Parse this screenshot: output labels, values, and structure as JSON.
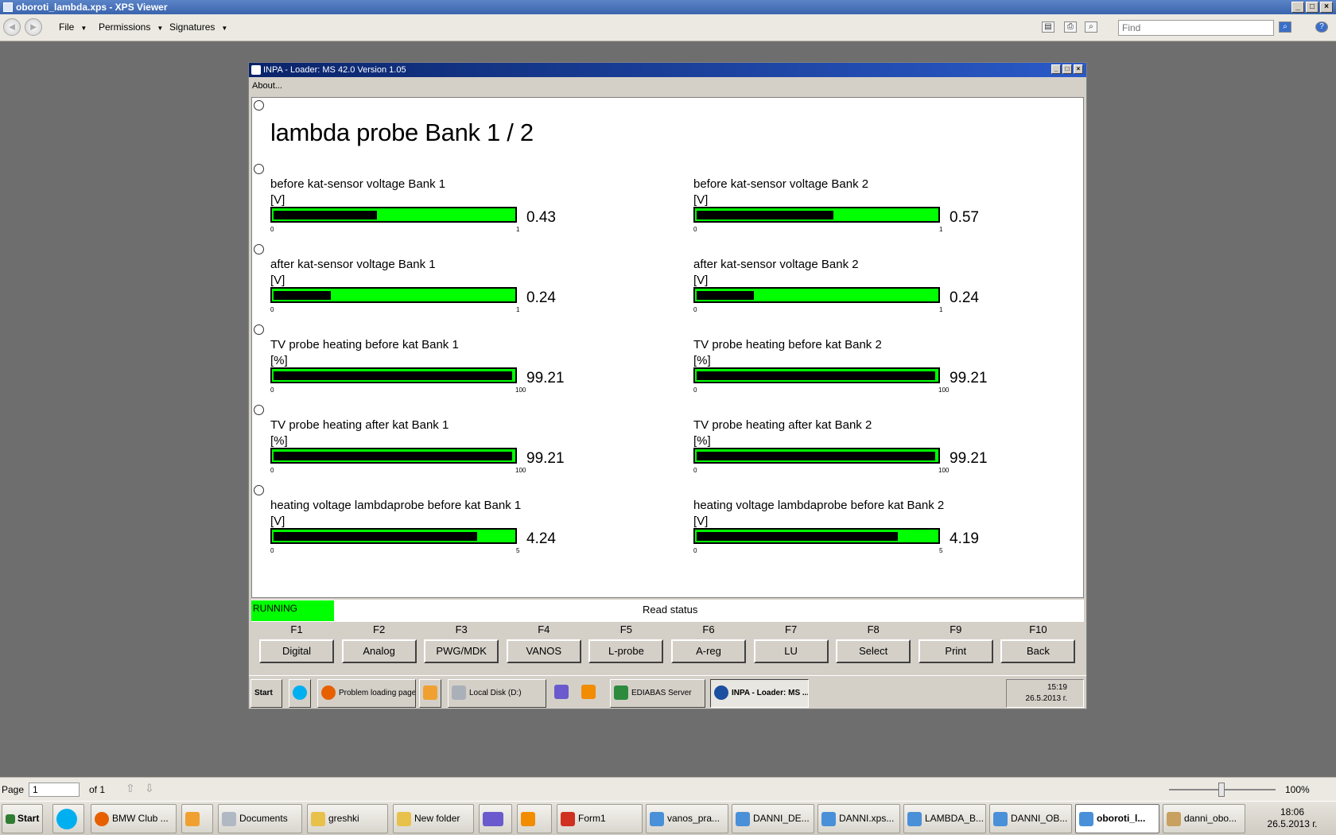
{
  "outer": {
    "title": "oboroti_lambda.xps - XPS Viewer",
    "menus": [
      "File",
      "Permissions",
      "Signatures"
    ],
    "find_placeholder": "Find",
    "page_label": "Page",
    "page_value": "1",
    "page_of": "of 1",
    "zoom": "100%"
  },
  "inner": {
    "title": "INPA - Loader:  MS 42.0 Version 1.05",
    "menu_about": "About...",
    "heading": "lambda probe Bank 1 / 2",
    "gauges": [
      {
        "label": "before kat-sensor voltage Bank 1",
        "unit": "[V]",
        "value": "0.43",
        "fraction": 0.43,
        "min": "0",
        "max": "1"
      },
      {
        "label": "before kat-sensor voltage Bank 2",
        "unit": "[V]",
        "value": "0.57",
        "fraction": 0.57,
        "min": "0",
        "max": "1"
      },
      {
        "label": "after kat-sensor voltage Bank 1",
        "unit": "[V]",
        "value": "0.24",
        "fraction": 0.24,
        "min": "0",
        "max": "1"
      },
      {
        "label": "after kat-sensor voltage Bank 2",
        "unit": "[V]",
        "value": "0.24",
        "fraction": 0.24,
        "min": "0",
        "max": "1"
      },
      {
        "label": "TV probe heating before kat Bank 1",
        "unit": "[%]",
        "value": "99.21",
        "fraction": 0.9921,
        "min": "0",
        "max": "100"
      },
      {
        "label": "TV probe heating before kat Bank 2",
        "unit": "[%]",
        "value": "99.21",
        "fraction": 0.9921,
        "min": "0",
        "max": "100"
      },
      {
        "label": "TV probe heating after kat Bank 1",
        "unit": "[%]",
        "value": "99.21",
        "fraction": 0.9921,
        "min": "0",
        "max": "100"
      },
      {
        "label": "TV probe heating after kat Bank 2",
        "unit": "[%]",
        "value": "99.21",
        "fraction": 0.9921,
        "min": "0",
        "max": "100"
      },
      {
        "label": "heating voltage lambdaprobe before kat Bank 1",
        "unit": "[V]",
        "value": "4.24",
        "fraction": 0.848,
        "min": "0",
        "max": "5"
      },
      {
        "label": "heating voltage lambdaprobe before kat Bank 2",
        "unit": "[V]",
        "value": "4.19",
        "fraction": 0.838,
        "min": "0",
        "max": "5"
      }
    ],
    "status": "RUNNING",
    "read_status": "Read status",
    "fkeys": [
      {
        "key": "F1",
        "label": "Digital"
      },
      {
        "key": "F2",
        "label": "Analog"
      },
      {
        "key": "F3",
        "label": "PWG/MDK"
      },
      {
        "key": "F4",
        "label": "VANOS"
      },
      {
        "key": "F5",
        "label": "L-probe"
      },
      {
        "key": "F6",
        "label": "A-reg"
      },
      {
        "key": "F7",
        "label": "LU"
      },
      {
        "key": "F8",
        "label": "Select"
      },
      {
        "key": "F9",
        "label": "Print"
      },
      {
        "key": "F10",
        "label": "Back"
      }
    ],
    "taskbar": {
      "start": "Start",
      "items": [
        "Problem loading page...",
        "Local Disk (D:)",
        "EDIABAS Server",
        "INPA - Loader:  MS ..."
      ],
      "time": "15:19",
      "date": "26.5.2013 г."
    }
  },
  "taskbar": {
    "start": "Start",
    "items": [
      "BMW Club ...",
      "Documents",
      "greshki",
      "New folder",
      "Form1",
      "vanos_pra...",
      "DANNI_DE...",
      "DANNI.xps...",
      "LAMBDA_B...",
      "DANNI_OB...",
      "oboroti_l...",
      "danni_obo..."
    ],
    "time": "18:06",
    "date": "26.5.2013 г."
  },
  "colors": {
    "gauge_bar": "#00ff00",
    "running": "#00ff00",
    "title_blue": "#0a246a"
  }
}
